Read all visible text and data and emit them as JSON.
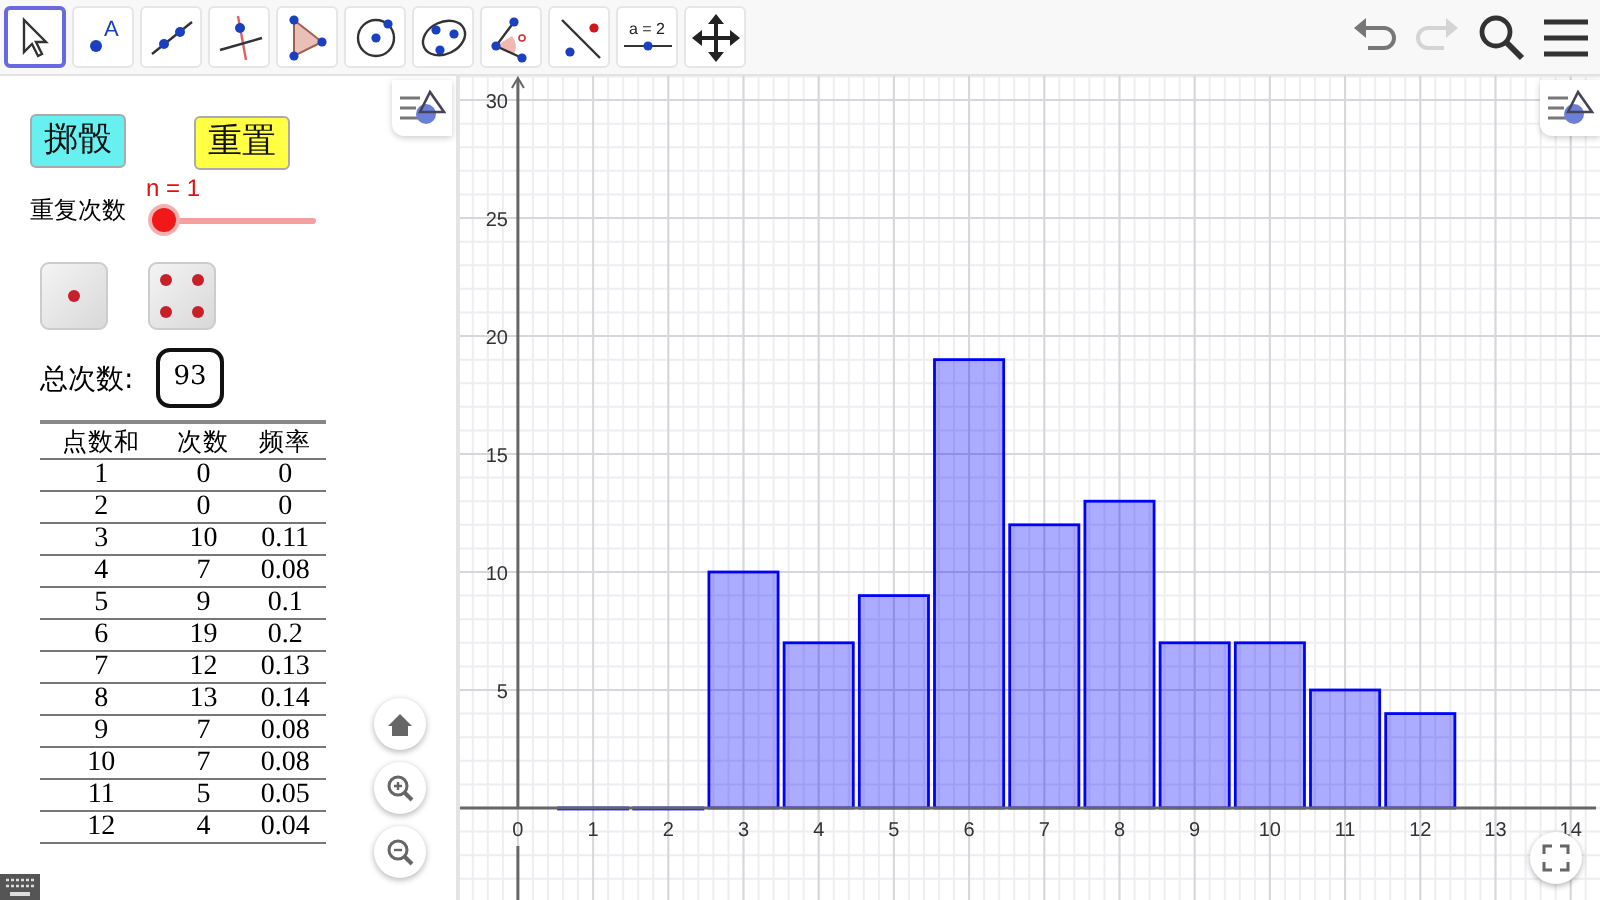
{
  "toolbar": {
    "tools": [
      {
        "kind": "move",
        "selected": true
      },
      {
        "kind": "point",
        "label": "A",
        "selected": false
      },
      {
        "kind": "line",
        "selected": false
      },
      {
        "kind": "perpendicular",
        "selected": false
      },
      {
        "kind": "polygon",
        "selected": false
      },
      {
        "kind": "circle",
        "selected": false
      },
      {
        "kind": "conic",
        "selected": false
      },
      {
        "kind": "angle",
        "selected": false
      },
      {
        "kind": "reflect",
        "selected": false
      },
      {
        "kind": "slider",
        "label": "a = 2",
        "selected": false
      },
      {
        "kind": "pan",
        "selected": false
      }
    ],
    "actions": [
      {
        "kind": "undo",
        "disabled": false
      },
      {
        "kind": "redo",
        "disabled": true
      },
      {
        "kind": "search",
        "disabled": false
      },
      {
        "kind": "menu",
        "disabled": false
      }
    ]
  },
  "left_panel": {
    "buttons": [
      {
        "label": "掷骰",
        "color": "#66f0f0"
      },
      {
        "label": "重置",
        "color": "#ffff44"
      }
    ],
    "slider": {
      "label": "重复次数",
      "caption": "n = 1",
      "level": 0
    },
    "dice": [
      {
        "kind": "one"
      },
      {
        "kind": "four"
      }
    ],
    "total": {
      "label": "总次数:",
      "value": "93"
    },
    "table": {
      "columns": [
        "点数和",
        "次数",
        "频率"
      ],
      "rows": [
        [
          "1",
          "0",
          "0"
        ],
        [
          "2",
          "0",
          "0"
        ],
        [
          "3",
          "10",
          "0.11"
        ],
        [
          "4",
          "7",
          "0.08"
        ],
        [
          "5",
          "9",
          "0.1"
        ],
        [
          "6",
          "19",
          "0.2"
        ],
        [
          "7",
          "12",
          "0.13"
        ],
        [
          "8",
          "13",
          "0.14"
        ],
        [
          "9",
          "7",
          "0.08"
        ],
        [
          "10",
          "7",
          "0.08"
        ],
        [
          "11",
          "5",
          "0.05"
        ],
        [
          "12",
          "4",
          "0.04"
        ]
      ]
    }
  },
  "graphics": {
    "chart_data": {
      "type": "bar",
      "x": [
        1,
        2,
        3,
        4,
        5,
        6,
        7,
        8,
        9,
        10,
        11,
        12
      ],
      "grid": true,
      "series": [
        {
          "color": "#0000ff",
          "values": [
            0,
            0,
            10,
            7,
            9,
            19,
            12,
            13,
            7,
            7,
            5,
            4
          ]
        }
      ],
      "xlim": [
        -0.77,
        14.39
      ],
      "ylim": [
        -3.9,
        31.02
      ],
      "xticks": [
        0,
        1,
        2,
        3,
        4,
        5,
        6,
        7,
        8,
        9,
        10,
        11,
        12,
        13,
        14
      ],
      "yticks": [
        5,
        10,
        15,
        20,
        25,
        30
      ]
    }
  }
}
